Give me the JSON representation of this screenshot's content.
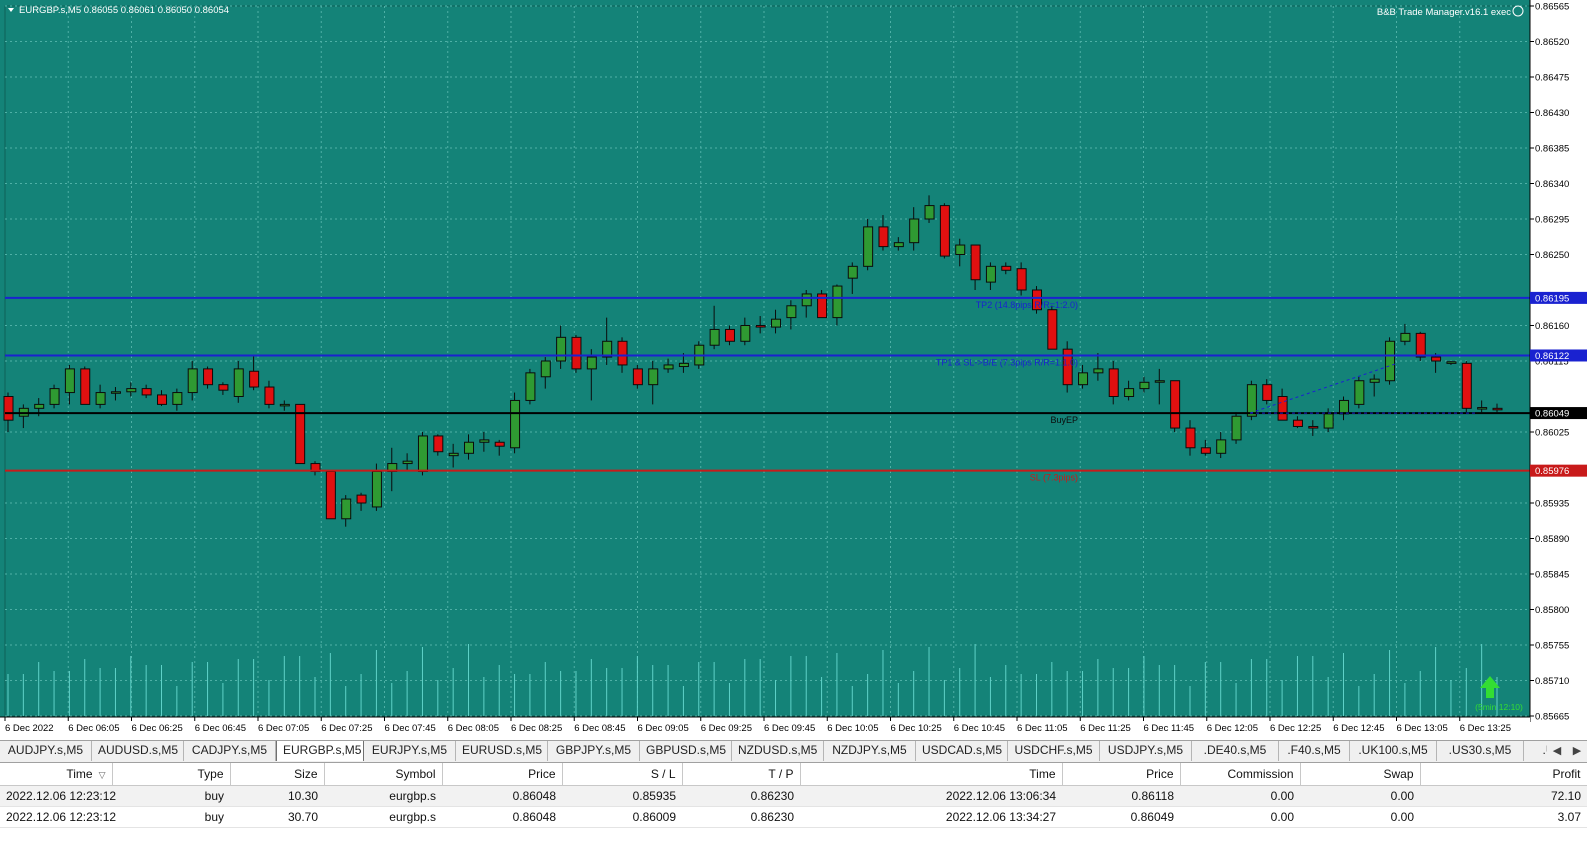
{
  "header": {
    "symbol_info": "EURGBP.s,M5  0.86055 0.86061 0.86050 0.86054",
    "ea_label": "B&B Trade Manager.v16.1 exec",
    "smiley_icon": "smiley-icon",
    "menu_icon": "triangle-down-icon"
  },
  "colors": {
    "background": "#148378",
    "grid": "#4fb0a6",
    "bull": "#2f9a32",
    "bear": "#e01010",
    "wick": "#0b0b0b",
    "tp_line": "#1a22d0",
    "entry_line": "#000000",
    "sl_line": "#c81a1a",
    "volume": "#5fd2c8",
    "axis_bg": "#ffffff",
    "axis_text": "#000000",
    "timer_arrow": "#33dd33"
  },
  "chart_data": {
    "type": "candlestick",
    "price_axis": {
      "min": 0.85665,
      "max": 0.86565,
      "tick_labels": [
        "0.86565",
        "0.86520",
        "0.86475",
        "0.86430",
        "0.86385",
        "0.86340",
        "0.86295",
        "0.86250",
        "0.86160",
        "0.86115",
        "0.86025",
        "0.85935",
        "0.85890",
        "0.85845",
        "0.85800",
        "0.85755",
        "0.85710",
        "0.85665"
      ]
    },
    "time_axis": {
      "tick_labels": [
        "6 Dec 2022",
        "6 Dec 06:05",
        "6 Dec 06:25",
        "6 Dec 06:45",
        "6 Dec 07:05",
        "6 Dec 07:25",
        "6 Dec 07:45",
        "6 Dec 08:05",
        "6 Dec 08:25",
        "6 Dec 08:45",
        "6 Dec 09:05",
        "6 Dec 09:25",
        "6 Dec 09:45",
        "6 Dec 10:05",
        "6 Dec 10:25",
        "6 Dec 10:45",
        "6 Dec 11:05",
        "6 Dec 11:25",
        "6 Dec 11:45",
        "6 Dec 12:05",
        "6 Dec 12:25",
        "6 Dec 12:45",
        "6 Dec 13:05",
        "6 Dec 13:25"
      ]
    },
    "grid": true,
    "candles": [
      [
        0.8607,
        0.86075,
        0.86025,
        0.8604
      ],
      [
        0.86045,
        0.8606,
        0.8603,
        0.86055
      ],
      [
        0.86055,
        0.86068,
        0.86045,
        0.8606
      ],
      [
        0.8606,
        0.86085,
        0.86055,
        0.8608
      ],
      [
        0.86075,
        0.8611,
        0.8606,
        0.86105
      ],
      [
        0.86105,
        0.86108,
        0.8606,
        0.8606
      ],
      [
        0.8606,
        0.86085,
        0.86055,
        0.86075
      ],
      [
        0.86075,
        0.86082,
        0.86065,
        0.86076
      ],
      [
        0.86076,
        0.86088,
        0.8607,
        0.8608
      ],
      [
        0.8608,
        0.86085,
        0.86068,
        0.86072
      ],
      [
        0.86072,
        0.86078,
        0.86058,
        0.8606
      ],
      [
        0.8606,
        0.8608,
        0.86052,
        0.86075
      ],
      [
        0.86075,
        0.86115,
        0.86065,
        0.86105
      ],
      [
        0.86105,
        0.86108,
        0.8608,
        0.86085
      ],
      [
        0.86085,
        0.86088,
        0.86072,
        0.86078
      ],
      [
        0.8607,
        0.86115,
        0.86062,
        0.86105
      ],
      [
        0.86102,
        0.86122,
        0.86078,
        0.86082
      ],
      [
        0.86082,
        0.8609,
        0.86055,
        0.8606
      ],
      [
        0.8606,
        0.86065,
        0.86052,
        0.8606
      ],
      [
        0.8606,
        0.8606,
        0.85985,
        0.85985
      ],
      [
        0.85985,
        0.85988,
        0.8597,
        0.85975
      ],
      [
        0.85975,
        0.85975,
        0.85915,
        0.85915
      ],
      [
        0.85915,
        0.85945,
        0.85905,
        0.8594
      ],
      [
        0.85945,
        0.85948,
        0.85925,
        0.85935
      ],
      [
        0.8593,
        0.85985,
        0.85925,
        0.85975
      ],
      [
        0.85975,
        0.86005,
        0.8595,
        0.85985
      ],
      [
        0.85985,
        0.85998,
        0.85975,
        0.85988
      ],
      [
        0.85975,
        0.86025,
        0.8597,
        0.8602
      ],
      [
        0.8602,
        0.86022,
        0.85995,
        0.86
      ],
      [
        0.85995,
        0.8601,
        0.8598,
        0.85998
      ],
      [
        0.85998,
        0.86022,
        0.8599,
        0.86012
      ],
      [
        0.86012,
        0.86025,
        0.86,
        0.86015
      ],
      [
        0.86012,
        0.86015,
        0.85995,
        0.86007
      ],
      [
        0.86005,
        0.86075,
        0.85998,
        0.86065
      ],
      [
        0.86065,
        0.86105,
        0.8606,
        0.861
      ],
      [
        0.86095,
        0.8612,
        0.8608,
        0.86115
      ],
      [
        0.86115,
        0.8616,
        0.86105,
        0.86145
      ],
      [
        0.86145,
        0.86148,
        0.861,
        0.86105
      ],
      [
        0.86105,
        0.8613,
        0.86065,
        0.8612
      ],
      [
        0.8612,
        0.8617,
        0.8611,
        0.8614
      ],
      [
        0.8614,
        0.86145,
        0.861,
        0.8611
      ],
      [
        0.86105,
        0.8611,
        0.8608,
        0.86085
      ],
      [
        0.86085,
        0.86115,
        0.8606,
        0.86105
      ],
      [
        0.86105,
        0.86118,
        0.861,
        0.8611
      ],
      [
        0.86108,
        0.86125,
        0.861,
        0.86112
      ],
      [
        0.8611,
        0.8614,
        0.86105,
        0.86135
      ],
      [
        0.86135,
        0.86185,
        0.8613,
        0.86155
      ],
      [
        0.86155,
        0.8616,
        0.86135,
        0.8614
      ],
      [
        0.8614,
        0.8617,
        0.86135,
        0.8616
      ],
      [
        0.8616,
        0.86172,
        0.8615,
        0.86158
      ],
      [
        0.86158,
        0.8618,
        0.8615,
        0.86168
      ],
      [
        0.8617,
        0.86192,
        0.86155,
        0.86185
      ],
      [
        0.86185,
        0.86205,
        0.8617,
        0.862
      ],
      [
        0.862,
        0.86205,
        0.8617,
        0.8617
      ],
      [
        0.8617,
        0.86212,
        0.8616,
        0.8621
      ],
      [
        0.8622,
        0.8624,
        0.862,
        0.86235
      ],
      [
        0.86235,
        0.86295,
        0.8623,
        0.86285
      ],
      [
        0.86285,
        0.863,
        0.86255,
        0.8626
      ],
      [
        0.8626,
        0.86272,
        0.86255,
        0.86265
      ],
      [
        0.86265,
        0.8631,
        0.86255,
        0.86295
      ],
      [
        0.86295,
        0.86325,
        0.8629,
        0.86312
      ],
      [
        0.86312,
        0.86315,
        0.86245,
        0.86248
      ],
      [
        0.8625,
        0.8627,
        0.86235,
        0.86262
      ],
      [
        0.86262,
        0.86262,
        0.86205,
        0.86218
      ],
      [
        0.86215,
        0.8624,
        0.86205,
        0.86235
      ],
      [
        0.86235,
        0.8624,
        0.86225,
        0.8623
      ],
      [
        0.86232,
        0.8624,
        0.86198,
        0.86205
      ],
      [
        0.86205,
        0.8621,
        0.86175,
        0.8618
      ],
      [
        0.8618,
        0.86185,
        0.8613,
        0.8613
      ],
      [
        0.8613,
        0.8614,
        0.86075,
        0.86085
      ],
      [
        0.86085,
        0.8611,
        0.8608,
        0.861
      ],
      [
        0.861,
        0.86125,
        0.8609,
        0.86105
      ],
      [
        0.86105,
        0.86115,
        0.8606,
        0.8607
      ],
      [
        0.8607,
        0.8609,
        0.86065,
        0.8608
      ],
      [
        0.8608,
        0.86095,
        0.86075,
        0.86088
      ],
      [
        0.8609,
        0.86105,
        0.8606,
        0.8609
      ],
      [
        0.8609,
        0.8609,
        0.86025,
        0.8603
      ],
      [
        0.8603,
        0.8604,
        0.85995,
        0.86005
      ],
      [
        0.86005,
        0.86015,
        0.85995,
        0.85998
      ],
      [
        0.85998,
        0.86025,
        0.85992,
        0.86015
      ],
      [
        0.86015,
        0.8605,
        0.8601,
        0.86045
      ],
      [
        0.86045,
        0.8609,
        0.8604,
        0.86085
      ],
      [
        0.86085,
        0.86092,
        0.8606,
        0.86065
      ],
      [
        0.8607,
        0.8608,
        0.8604,
        0.8604
      ],
      [
        0.8604,
        0.86045,
        0.8603,
        0.86032
      ],
      [
        0.86032,
        0.8604,
        0.8602,
        0.8603
      ],
      [
        0.8603,
        0.86055,
        0.86025,
        0.86048
      ],
      [
        0.86048,
        0.8607,
        0.8604,
        0.86065
      ],
      [
        0.8606,
        0.86095,
        0.86055,
        0.8609
      ],
      [
        0.86088,
        0.86098,
        0.8607,
        0.86092
      ],
      [
        0.8609,
        0.86145,
        0.86085,
        0.8614
      ],
      [
        0.8614,
        0.86162,
        0.86135,
        0.8615
      ],
      [
        0.8615,
        0.86152,
        0.86115,
        0.8612
      ],
      [
        0.8612,
        0.86125,
        0.861,
        0.86115
      ],
      [
        0.86112,
        0.86115,
        0.8611,
        0.86114
      ],
      [
        0.86112,
        0.86115,
        0.8605,
        0.86055
      ],
      [
        0.86055,
        0.86065,
        0.8605,
        0.86056
      ],
      [
        0.86055,
        0.86061,
        0.8605,
        0.86054
      ]
    ],
    "levels": [
      {
        "role": "tp2",
        "price": 0.86195,
        "label": "TP2 (14.8pips R/R=1:2.0)",
        "price_label": "0.86195"
      },
      {
        "role": "tp1",
        "price": 0.86122,
        "label": "TP1 & SL->B/E (7.3pips R/R=1:1.0)",
        "price_label": "0.86122"
      },
      {
        "role": "entry",
        "price": 0.86049,
        "label": "BuyEP",
        "price_label": "0.86049"
      },
      {
        "role": "sl",
        "price": 0.85976,
        "label": "SL (7.3pips)",
        "price_label": "0.85976"
      }
    ],
    "timer_label": "(5min 12:10)"
  },
  "symbol_tabs": {
    "items": [
      {
        "label": "AUDJPY.s,M5"
      },
      {
        "label": "AUDUSD.s,M5"
      },
      {
        "label": "CADJPY.s,M5"
      },
      {
        "label": "EURGBP.s,M5"
      },
      {
        "label": "EURJPY.s,M5"
      },
      {
        "label": "EURUSD.s,M5"
      },
      {
        "label": "GBPJPY.s,M5"
      },
      {
        "label": "GBPUSD.s,M5"
      },
      {
        "label": "NZDUSD.s,M5"
      },
      {
        "label": "NZDJPY.s,M5"
      },
      {
        "label": "USDCAD.s,M5"
      },
      {
        "label": "USDCHF.s,M5"
      },
      {
        "label": "USDJPY.s,M5"
      },
      {
        "label": ".DE40.s,M5"
      },
      {
        "label": ".F40.s,M5"
      },
      {
        "label": ".UK100.s,M5"
      },
      {
        "label": ".US30.s,M5"
      },
      {
        "label": ".U"
      }
    ],
    "active": "EURGBP.s,M5",
    "scroll_left_icon": "triangle-left-icon",
    "scroll_right_icon": "triangle-right-icon"
  },
  "trades": {
    "columns": [
      "Time",
      "Type",
      "Size",
      "Symbol",
      "Price",
      "S / L",
      "T / P",
      "Time",
      "Price",
      "Commission",
      "Swap",
      "Profit"
    ],
    "sort_icon": "sort-arrow-icon",
    "rows": [
      [
        "2022.12.06 12:23:12",
        "buy",
        "10.30",
        "eurgbp.s",
        "0.86048",
        "0.85935",
        "0.86230",
        "2022.12.06 13:06:34",
        "0.86118",
        "0.00",
        "0.00",
        "72.10"
      ],
      [
        "2022.12.06 12:23:12",
        "buy",
        "30.70",
        "eurgbp.s",
        "0.86048",
        "0.86009",
        "0.86230",
        "2022.12.06 13:34:27",
        "0.86049",
        "0.00",
        "0.00",
        "3.07"
      ]
    ]
  }
}
